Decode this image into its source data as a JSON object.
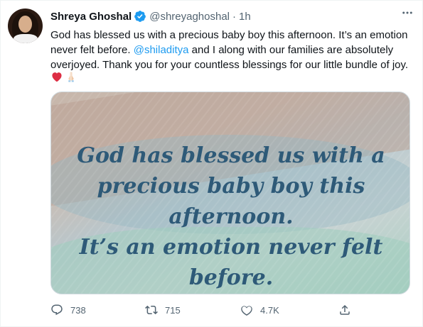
{
  "author": {
    "name": "Shreya Ghoshal",
    "handle": "@shreyaghoshal",
    "separator": "·",
    "time": "1h"
  },
  "tweet": {
    "text_part1": "God has blessed us with a precious baby boy this afternoon. It’s an emotion never felt before. ",
    "mention": "@shiladitya",
    "text_part2": " and I along with our families are absolutely overjoyed. Thank you for your countless blessings for our little bundle of joy."
  },
  "media": {
    "line1": "God has blessed us with a",
    "line2": "precious baby boy this",
    "line3": "afternoon.",
    "line4": "It’s an emotion never felt",
    "line5": "before."
  },
  "actions": {
    "reply_count": "738",
    "retweet_count": "715",
    "like_count": "4.7K"
  },
  "icons": [
    "verified-badge-icon",
    "more-icon",
    "heart-emoji-icon",
    "folded-hands-emoji-icon",
    "reply-icon",
    "retweet-icon",
    "like-icon",
    "share-icon"
  ],
  "colors": {
    "link": "#1d9bf0",
    "muted": "#536471",
    "quote_text": "#2e5a78"
  }
}
